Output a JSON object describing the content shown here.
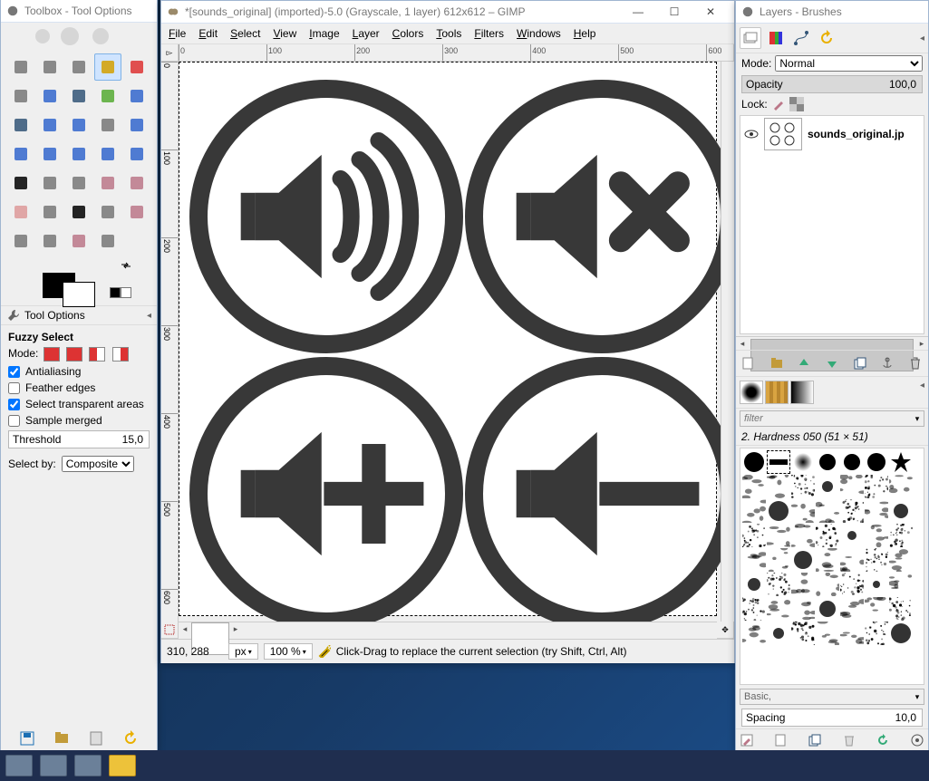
{
  "toolbox": {
    "title": "Toolbox - Tool Options",
    "tools": [
      "rect-select",
      "ellipse-select",
      "free-select",
      "fuzzy-select",
      "by-color-select",
      "scissors",
      "foreground-select",
      "paths",
      "color-picker",
      "zoom",
      "measure",
      "move",
      "align",
      "crop",
      "rotate",
      "scale",
      "shear",
      "perspective",
      "flip",
      "cage",
      "text",
      "bucket-fill",
      "blend",
      "pencil",
      "paintbrush",
      "eraser",
      "airbrush",
      "ink",
      "clone",
      "heal",
      "perspective-clone",
      "blur",
      "smudge",
      "dodge"
    ],
    "active_tool_index": 3,
    "opt_header_icon": "wrench",
    "opt_header_label": "Tool Options",
    "tool_name": "Fuzzy Select",
    "mode_label": "Mode:",
    "antialias_label": "Antialiasing",
    "antialias_checked": true,
    "feather_label": "Feather edges",
    "feather_checked": false,
    "transparent_label": "Select transparent areas",
    "transparent_checked": true,
    "sample_label": "Sample merged",
    "sample_checked": false,
    "threshold_label": "Threshold",
    "threshold_value": "15,0",
    "selectby_label": "Select by:",
    "selectby_value": "Composite"
  },
  "imgwin": {
    "title": "*[sounds_original] (imported)-5.0 (Grayscale, 1 layer) 612x612 – GIMP",
    "menu": [
      "File",
      "Edit",
      "Select",
      "View",
      "Image",
      "Layer",
      "Colors",
      "Tools",
      "Filters",
      "Windows",
      "Help"
    ],
    "ruler_ticks": [
      0,
      100,
      200,
      300,
      400,
      500,
      600
    ],
    "status_coords": "310, 288",
    "unit": "px",
    "zoom": "100 %",
    "hint": "Click-Drag to replace the current selection (try Shift, Ctrl, Alt)"
  },
  "layers": {
    "title": "Layers - Brushes",
    "mode_label": "Mode:",
    "mode_value": "Normal",
    "opacity_label": "Opacity",
    "opacity_value": "100,0",
    "lock_label": "Lock:",
    "layer_name": "sounds_original.jp",
    "filter_placeholder": "filter",
    "brush_name": "2. Hardness 050 (51 × 51)",
    "basic_label": "Basic,",
    "spacing_label": "Spacing",
    "spacing_value": "10,0"
  }
}
